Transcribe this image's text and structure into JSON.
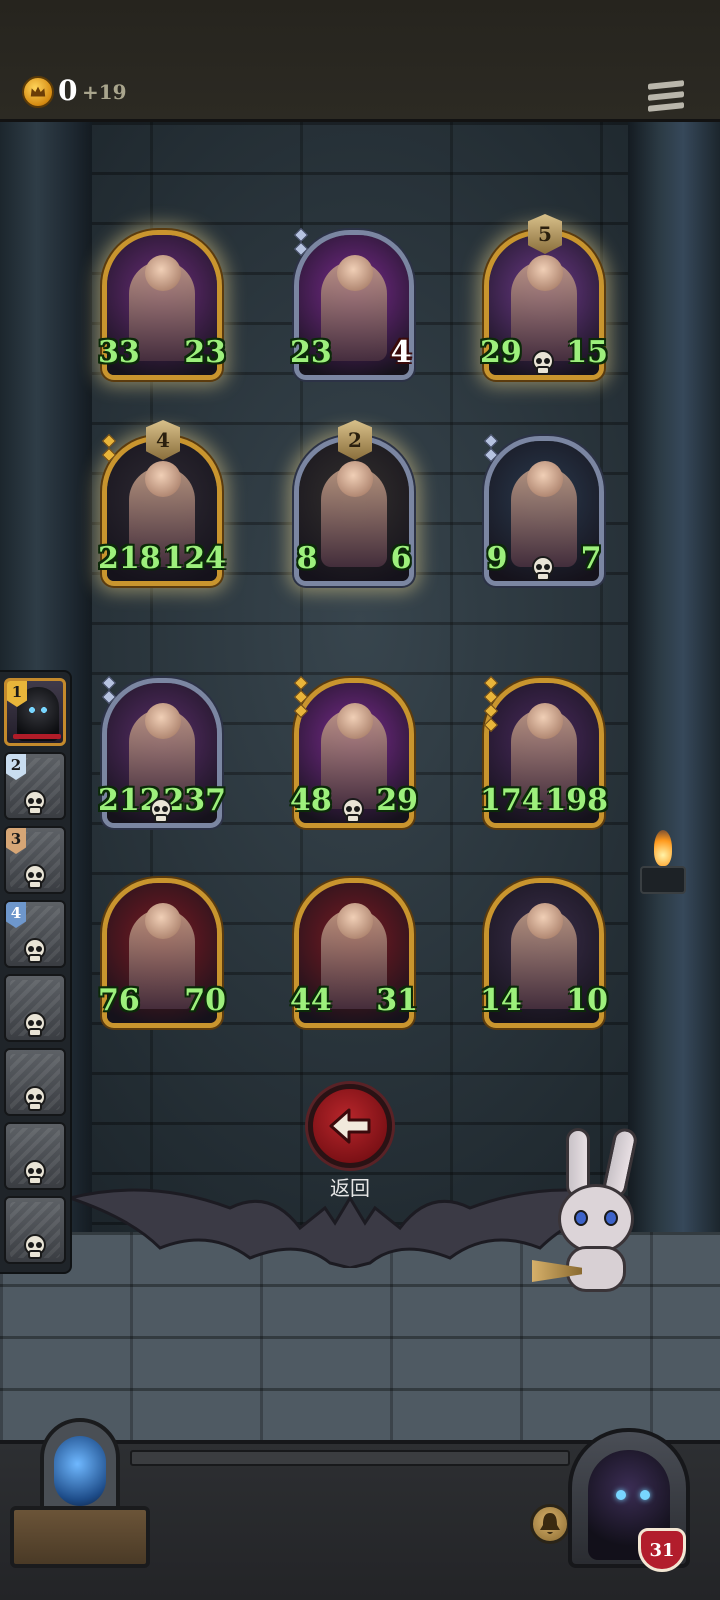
{
  "topbar": {
    "gold_value": "0",
    "gold_delta": "+19",
    "icons": {
      "coin": "crown-coin-icon",
      "menu": "menu-icon"
    }
  },
  "roster": [
    {
      "tier": "1",
      "tier_color": "gold",
      "active": true,
      "portrait": "hooded-figure"
    },
    {
      "tier": "2",
      "tier_color": "silver",
      "active": false,
      "portrait": "defeated"
    },
    {
      "tier": "3",
      "tier_color": "bronze",
      "active": false,
      "portrait": "defeated"
    },
    {
      "tier": "4",
      "tier_color": "blue",
      "active": false,
      "portrait": "defeated"
    },
    {
      "tier": "",
      "active": false,
      "portrait": "defeated"
    },
    {
      "tier": "",
      "active": false,
      "portrait": "defeated"
    },
    {
      "tier": "",
      "active": false,
      "portrait": "defeated"
    },
    {
      "tier": "",
      "active": false,
      "portrait": "defeated"
    }
  ],
  "cards": [
    {
      "id": "swashbuckler",
      "atk": "33",
      "hp": "23",
      "frame": "gold",
      "glow": true,
      "tier": "",
      "skull": false,
      "gems": 0,
      "art": "#6a2d7a"
    },
    {
      "id": "ribbon-girl",
      "atk": "23",
      "hp": "4",
      "frame": "silver",
      "glow": false,
      "tier": "",
      "skull": false,
      "gems": 2,
      "hp_style": "white",
      "art": "#7a2b8f"
    },
    {
      "id": "old-dwarf",
      "atk": "29",
      "hp": "15",
      "frame": "gold",
      "glow": true,
      "tier": "5",
      "skull": true,
      "gems": 0,
      "art": "#6d3a8a"
    },
    {
      "id": "skeleton-fiddler",
      "atk": "218",
      "hp": "124",
      "frame": "gold",
      "glow": true,
      "tier": "4",
      "skull": false,
      "gems": 2,
      "art": "#2e2a33"
    },
    {
      "id": "shield-knight",
      "atk": "8",
      "hp": "6",
      "frame": "silver",
      "glow": true,
      "tier": "2",
      "skull": false,
      "gems": 0,
      "art": "#33302e"
    },
    {
      "id": "barbarian",
      "atk": "9",
      "hp": "7",
      "frame": "silver",
      "glow": false,
      "tier": "",
      "skull": true,
      "gems": 2,
      "hp_style": "burst",
      "art": "#2a3a4e"
    },
    {
      "id": "harlequin",
      "atk": "212",
      "hp": "237",
      "frame": "silver",
      "glow": false,
      "tier": "",
      "skull": true,
      "gems": 2,
      "art": "#5a2e6a"
    },
    {
      "id": "ribbon-girl-gold",
      "atk": "48",
      "hp": "29",
      "frame": "gold",
      "glow": false,
      "tier": "",
      "skull": true,
      "gems": 3,
      "hp_style": "burst",
      "art": "#7a2b8f"
    },
    {
      "id": "zeppelin",
      "atk": "174",
      "hp": "198",
      "frame": "gold",
      "glow": false,
      "tier": "",
      "skull": false,
      "gems": 4,
      "art": "#4a2a5e"
    },
    {
      "id": "ghost-summoner",
      "atk": "76",
      "hp": "70",
      "frame": "gold",
      "glow": false,
      "tier": "",
      "skull": false,
      "gems": 0,
      "art": "#7a1a22"
    },
    {
      "id": "ghost-summoner-2",
      "atk": "44",
      "hp": "31",
      "frame": "gold",
      "glow": false,
      "tier": "",
      "skull": false,
      "gems": 0,
      "art": "#7a1a22"
    },
    {
      "id": "clown",
      "atk": "14",
      "hp": "10",
      "frame": "gold",
      "glow": false,
      "tier": "",
      "skull": false,
      "gems": 0,
      "art": "#3a2e4a"
    }
  ],
  "back": {
    "label": "返回",
    "icon": "arrow-left-icon"
  },
  "bottom": {
    "player_hp": "31",
    "icons": {
      "chest": "orb-chest-icon",
      "bell": "bell-icon",
      "hp": "heart-shield-icon"
    }
  },
  "colors": {
    "stat_text": "#9df07c",
    "gold_frame": "#c9952e",
    "silver_frame": "#7b86a2",
    "back_button": "#b8262b"
  }
}
